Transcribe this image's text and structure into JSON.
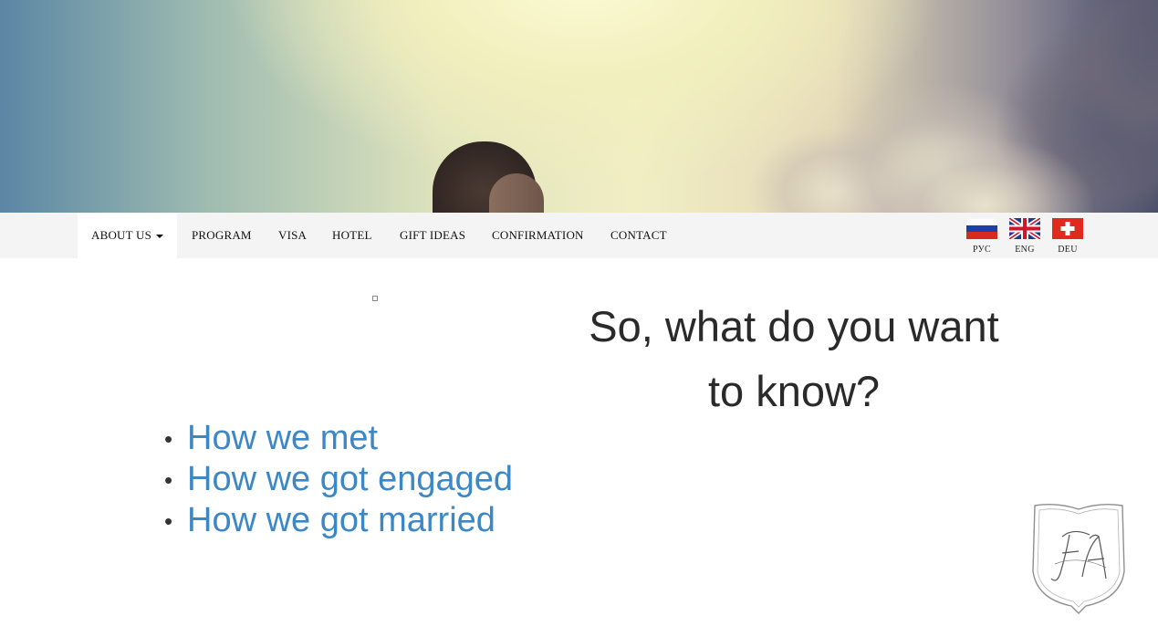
{
  "nav": {
    "items": [
      {
        "label": "ABOUT US",
        "active": true,
        "dropdown": true
      },
      {
        "label": "PROGRAM"
      },
      {
        "label": "VISA"
      },
      {
        "label": "HOTEL"
      },
      {
        "label": "GIFT IDEAS"
      },
      {
        "label": "CONFIRMATION"
      },
      {
        "label": "CONTACT"
      }
    ]
  },
  "languages": [
    {
      "code": "РУС",
      "flag": "russia-flag-icon"
    },
    {
      "code": "ENG",
      "flag": "uk-flag-icon"
    },
    {
      "code": "DEU",
      "flag": "swiss-flag-icon"
    }
  ],
  "main": {
    "heading": "So, what do you want to know?",
    "links": [
      "How we met",
      "How we got engaged",
      "How we got married"
    ]
  },
  "logo": {
    "monogram": "FA",
    "icon": "monogram-crest-icon"
  },
  "colors": {
    "link": "#3c87c6",
    "navbar_bg": "#f4f4f4",
    "heading": "#2a2a2a"
  }
}
